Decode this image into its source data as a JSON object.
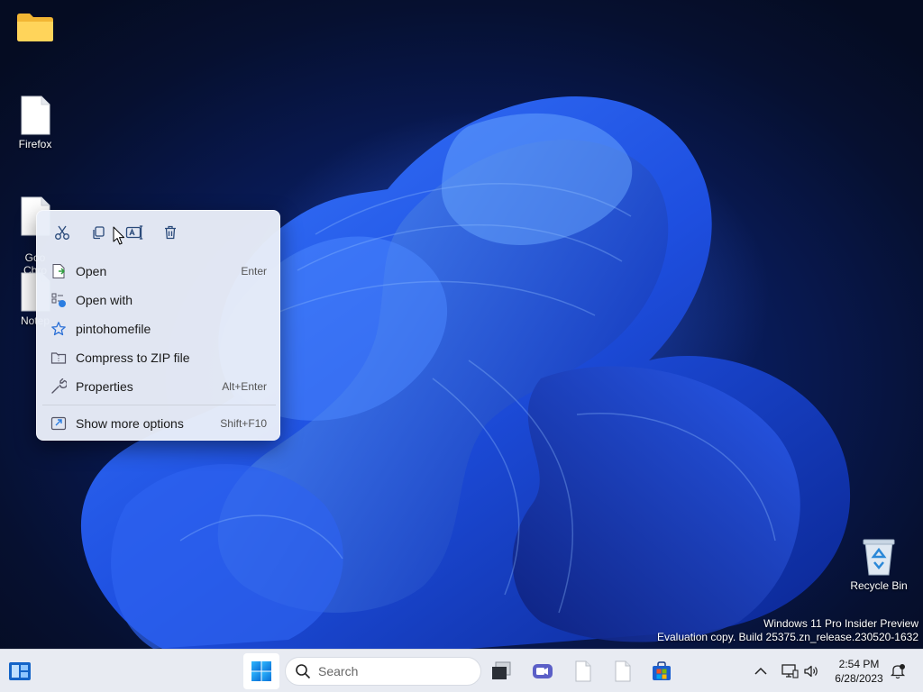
{
  "desktop": {
    "icons": [
      {
        "label": "",
        "kind": "folder-icon"
      },
      {
        "label": "Firefox",
        "kind": "file-icon"
      },
      {
        "label": "Goo\nChro",
        "kind": "file-icon"
      },
      {
        "label": "Notep",
        "kind": "file-icon"
      },
      {
        "label": "Recycle Bin",
        "kind": "recycle-bin-icon"
      }
    ]
  },
  "context_menu": {
    "quick_actions": [
      "cut-icon",
      "copy-icon",
      "rename-icon",
      "delete-icon"
    ],
    "items": [
      {
        "label": "Open",
        "shortcut": "Enter",
        "icon": "open-file-icon"
      },
      {
        "label": "Open with",
        "shortcut": "",
        "icon": "open-with-icon"
      },
      {
        "label": "pintohomefile",
        "shortcut": "",
        "icon": "star-icon"
      },
      {
        "label": "Compress to ZIP file",
        "shortcut": "",
        "icon": "zip-folder-icon"
      },
      {
        "label": "Properties",
        "shortcut": "Alt+Enter",
        "icon": "wrench-icon"
      }
    ],
    "more_options": {
      "label": "Show more options",
      "shortcut": "Shift+F10",
      "icon": "more-options-icon"
    }
  },
  "watermark": {
    "line1": "Windows 11 Pro Insider Preview",
    "line2": "Evaluation copy. Build 25375.zn_release.230520-1632"
  },
  "taskbar": {
    "search_placeholder": "Search",
    "pinned": [
      "widgets-icon",
      "start-icon",
      "task-view-icon",
      "meet-icon",
      "file-icon",
      "file-icon",
      "store-icon"
    ],
    "tray": {
      "time": "2:54 PM",
      "date": "6/28/2023",
      "icons": [
        "chevron-up-icon",
        "network-icon",
        "volume-icon",
        "notification-icon"
      ]
    }
  },
  "colors": {
    "accent": "#0078d4",
    "menu_bg": "#e8edf8",
    "taskbar_bg": "#e8ebf2"
  }
}
